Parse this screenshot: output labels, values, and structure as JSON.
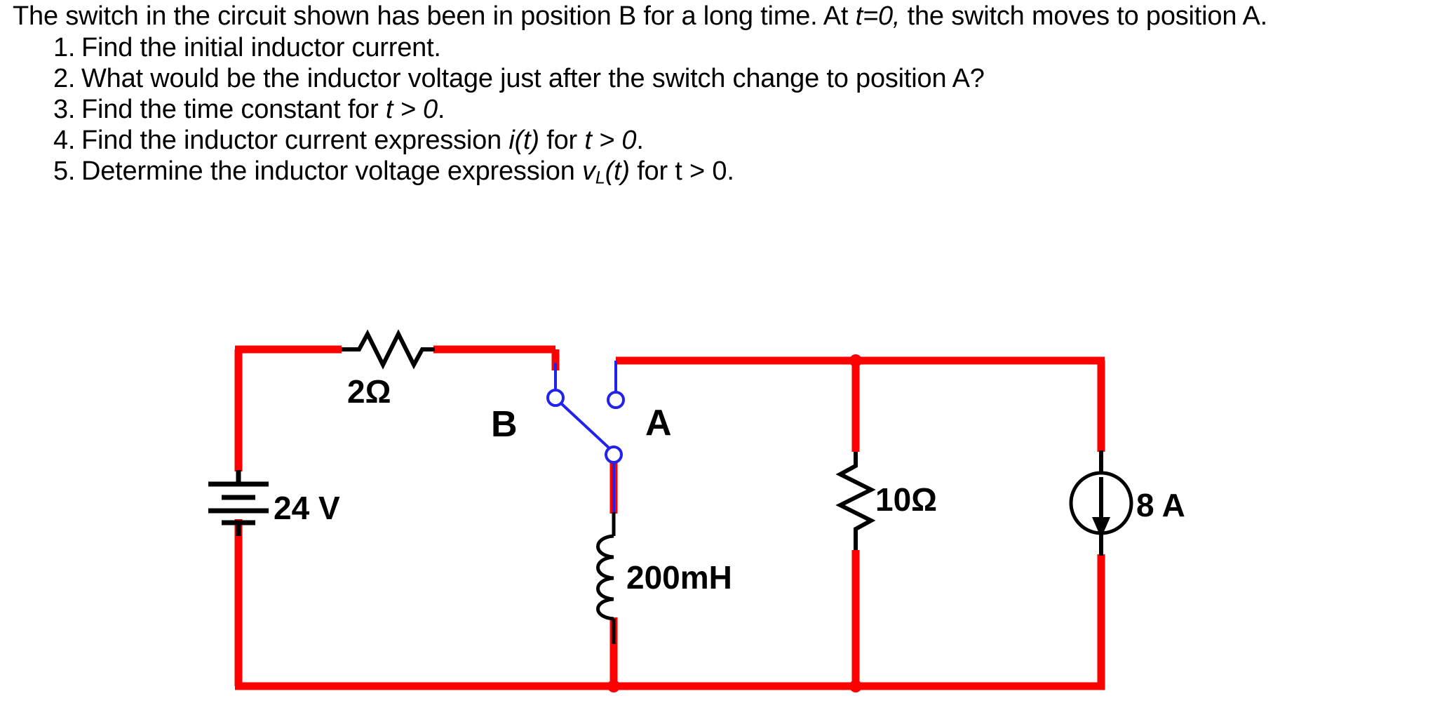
{
  "problem": {
    "intro_part1": "The switch in the circuit shown has been in position B for a long time. At ",
    "intro_italic": "t=0,",
    "intro_part2": " the switch moves to position A.",
    "questions": [
      {
        "num": "1.",
        "text_before": "Find the initial inductor current.",
        "italic1": "",
        "text_mid": "",
        "italic2": "",
        "text_after": ""
      },
      {
        "num": "2.",
        "text_before": "What would be the inductor voltage just after the switch change to position A?",
        "italic1": "",
        "text_mid": "",
        "italic2": "",
        "text_after": ""
      },
      {
        "num": "3.",
        "text_before": "Find the time constant for ",
        "italic1": "t > 0",
        "text_mid": ".",
        "italic2": "",
        "text_after": ""
      },
      {
        "num": "4.",
        "text_before": "Find the inductor current expression ",
        "italic1": "i(t)",
        "text_mid": " for ",
        "italic2": "t > 0",
        "text_after": "."
      },
      {
        "num": "5.",
        "text_before": "Determine the inductor voltage expression ",
        "italic1": "v",
        "text_mid": "(t)",
        "italic2": " for t > 0",
        "text_after": "."
      }
    ],
    "q5_subscript": "L"
  },
  "circuit": {
    "title": "RL circuit with two-position switch",
    "components": [
      {
        "id": "voltage-source",
        "label": "24 V",
        "type": "dc-voltage-source",
        "value": "24",
        "unit": "V"
      },
      {
        "id": "resistor-2ohm",
        "label": "2Ω",
        "type": "resistor",
        "value": "2",
        "unit": "Ω"
      },
      {
        "id": "inductor",
        "label": "200mH",
        "type": "inductor",
        "value": "200",
        "unit": "mH"
      },
      {
        "id": "resistor-10ohm",
        "label": "10Ω",
        "type": "resistor",
        "value": "10",
        "unit": "Ω"
      },
      {
        "id": "current-source",
        "label": "8 A",
        "type": "dc-current-source",
        "value": "8",
        "unit": "A"
      }
    ],
    "switch": {
      "terminal_b_label": "B",
      "terminal_a_label": "A",
      "connected_to": "B"
    },
    "colors": {
      "wire": "#FF0000",
      "component": "#000000",
      "switch": "#2222EE",
      "background": "#FFFFFF"
    }
  }
}
